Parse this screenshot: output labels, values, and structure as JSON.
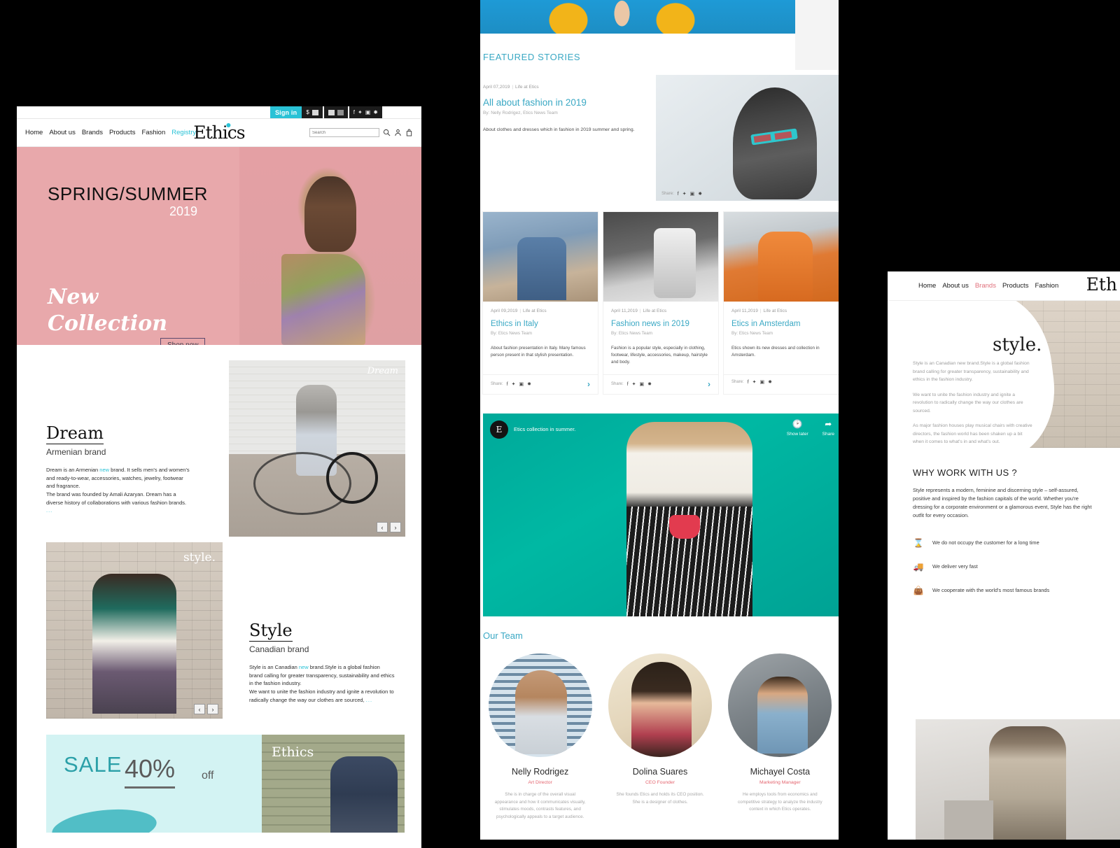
{
  "left": {
    "topbar": {
      "signin": "Sign in",
      "currency": "$"
    },
    "nav": [
      "Home",
      "About us",
      "Brands",
      "Products",
      "Fashion",
      "Registry"
    ],
    "nav_accent": "Registry",
    "logo": "Ethics",
    "search_placeholder": "Search",
    "hero": {
      "title": "SPRING/SUMMER",
      "year": "2019",
      "script_line1": "New",
      "script_line2": "Collection",
      "cta": "Shop now"
    },
    "dream": {
      "title": "Dream",
      "subtitle": "Armenian brand",
      "body_a": "Dream is an Armenian ",
      "new": "new",
      "body_b": " brand. It sells men's and women's and ready-to-wear, accessories, watches, jewelry, footwear and fragrance.",
      "body_c": "The brand was founded by Amali Azaryan. Dream has a diverse history of collaborations with various fashion brands.",
      "more": "...",
      "image_script": "Dream",
      "prev": "‹",
      "next": "›"
    },
    "style": {
      "title": "Style",
      "subtitle": "Canadian brand",
      "body_a": "Style is an Canadian ",
      "new": "new",
      "body_b": " brand.Style is a global fashion brand calling for greater transparency, sustainability and ethics in the fashion industry.",
      "body_c": "We want to unite the fashion industry and ignite a revolution to radically change the way our clothes are sourced,",
      "more": "...",
      "image_word": "style.",
      "prev": "‹",
      "next": "›"
    },
    "sale": {
      "label": "SALE",
      "percent": "40%",
      "off": "off",
      "logo": "Ethics"
    }
  },
  "mid": {
    "featured_title": "FEATURED STORIES",
    "feature": {
      "date": "April 07,2019",
      "category": "Life at Etics",
      "title": "All about fashion in 2019",
      "by": "By: Nelly Rodrigez, Etics News Team",
      "desc": "About clothes and dresses which in fashion in 2019 summer and spring.",
      "share_label": "Share:"
    },
    "cards": [
      {
        "date": "April 09,2019",
        "category": "Life at Etics",
        "title": "Ethics in Italy",
        "by": "By: Etics News Team",
        "desc": "About fashion presentation in Italy. Many famous person present in that stylish presentation.",
        "share_label": "Share:"
      },
      {
        "date": "April 11,2019",
        "category": "Life at Etics",
        "title": "Fashion news in 2019",
        "by": "By: Etics News Team",
        "desc": "Fashion is a popular style, especially in clothing, footwear, lifestyle, accessories, makeup, hairstyle and body.",
        "share_label": "Share:"
      },
      {
        "date": "April 11,2019",
        "category": "Life at Etics",
        "title": "Etics in Amsterdam",
        "by": "By: Etics News Team",
        "desc": "Etics shown its new dresses and collection in Amsterdam.",
        "share_label": "Share:"
      }
    ],
    "video": {
      "logo": "E",
      "caption": "Etics collection in summer.",
      "show_later": "Show later",
      "share": "Share"
    },
    "team_title": "Our Team",
    "team": [
      {
        "name": "Nelly Rodrigez",
        "role": "Art Director",
        "desc": "She is in charge of the overall visual appearance and how it communicates visually, stimulates moods, contrasts features, and psychologically appeals to a target audience."
      },
      {
        "name": "Dolina Suares",
        "role": "CEO Founder",
        "desc": "She founds Etics and holds its CEO position. She is a designer of clothes."
      },
      {
        "name": "Michayel Costa",
        "role": "Marketing Manager",
        "desc": "He employs tools from economics and competitive strategy to analyze the industry context in which Etics operates."
      }
    ]
  },
  "right": {
    "nav": [
      "Home",
      "About us",
      "Brands",
      "Products",
      "Fashion"
    ],
    "nav_accent": "Brands",
    "logo": "Eth",
    "style_word": "style.",
    "copy": [
      "Style is an Canadian new brand.Style is a global fashion brand calling for greater transparency, sustainability and ethics in the fashion industry.",
      "We want to unite the fashion industry and ignite a revolution to radically change the way our clothes are sourced.",
      "As major fashion houses play musical chairs with creative directors, the fashion world has been shaken up a bit when it comes to what's in and what's out."
    ],
    "why_title": "WHY WORK WITH US ?",
    "why_text": "Style represents a modern, feminine and discerning style – self-assured, positive and inspired by the fashion capitals of the world. Whether you're dressing for a corporate environment or a glamorous event, Style has the right outfit for every occasion.",
    "bullets": [
      {
        "icon": "⌛",
        "text": "We do not occupy the customer for a long time"
      },
      {
        "icon": "🚚",
        "text": "We deliver very fast"
      },
      {
        "icon": "👜",
        "text": "We cooperate with the world's most famous brands"
      }
    ]
  },
  "colors": {
    "accent_teal": "#29c2d6",
    "story_teal": "#3aa8c4",
    "pink": "#e8a8ab",
    "role_red": "#e4646e"
  }
}
